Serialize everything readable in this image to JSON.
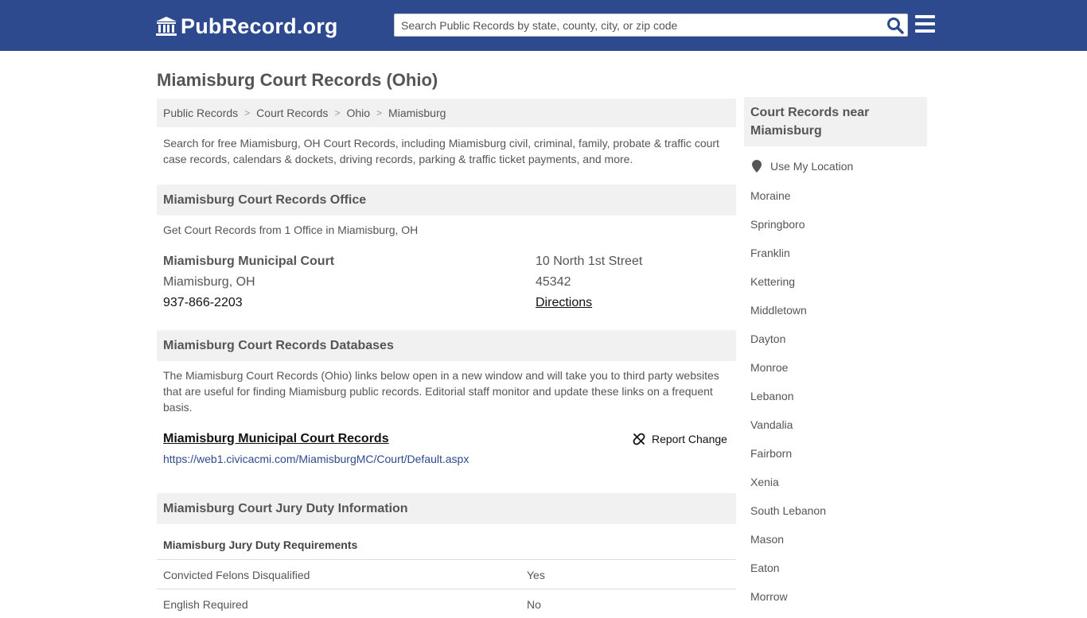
{
  "header": {
    "logo_text": "PubRecord.org",
    "search_placeholder": "Search Public Records by state, county, city, or zip code",
    "colors": {
      "header_bg": "#2e4a8f",
      "panel_bg": "#f1f1f1",
      "link": "#2e4a8f"
    }
  },
  "page_title": "Miamisburg Court Records (Ohio)",
  "breadcrumb": [
    "Public Records",
    "Court Records",
    "Ohio",
    "Miamisburg"
  ],
  "intro": "Search for free Miamisburg, OH Court Records, including Miamisburg civil, criminal, family, probate & traffic court case records, calendars & dockets, driving records, parking & traffic ticket payments, and more.",
  "office_section": {
    "heading": "Miamisburg Court Records Office",
    "subtitle": "Get Court Records from 1 Office in Miamisburg, OH",
    "office": {
      "name": "Miamisburg Municipal Court",
      "city": "Miamisburg, OH",
      "phone": "937-866-2203",
      "street": "10 North 1st Street",
      "zip": "45342",
      "directions_label": "Directions"
    }
  },
  "databases_section": {
    "heading": "Miamisburg Court Records Databases",
    "description": "The Miamisburg Court Records (Ohio) links below open in a new window and will take you to third party websites that are useful for finding Miamisburg public records. Editorial staff monitor and update these links on a frequent basis.",
    "link_title": "Miamisburg Municipal Court Records",
    "link_url": "https://web1.civicacmi.com/MiamisburgMC/Court/Default.aspx",
    "report_label": "Report Change"
  },
  "jury_section": {
    "heading": "Miamisburg Court Jury Duty Information",
    "subheading": "Miamisburg Jury Duty Requirements",
    "rows": [
      {
        "label": "Convicted Felons Disqualified",
        "value": "Yes"
      },
      {
        "label": "English Required",
        "value": "No"
      }
    ]
  },
  "sidebar": {
    "heading": "Court Records near Miamisburg",
    "use_location": "Use My Location",
    "cities": [
      "Moraine",
      "Springboro",
      "Franklin",
      "Kettering",
      "Middletown",
      "Dayton",
      "Monroe",
      "Lebanon",
      "Vandalia",
      "Fairborn",
      "Xenia",
      "South Lebanon",
      "Mason",
      "Eaton",
      "Morrow"
    ]
  }
}
